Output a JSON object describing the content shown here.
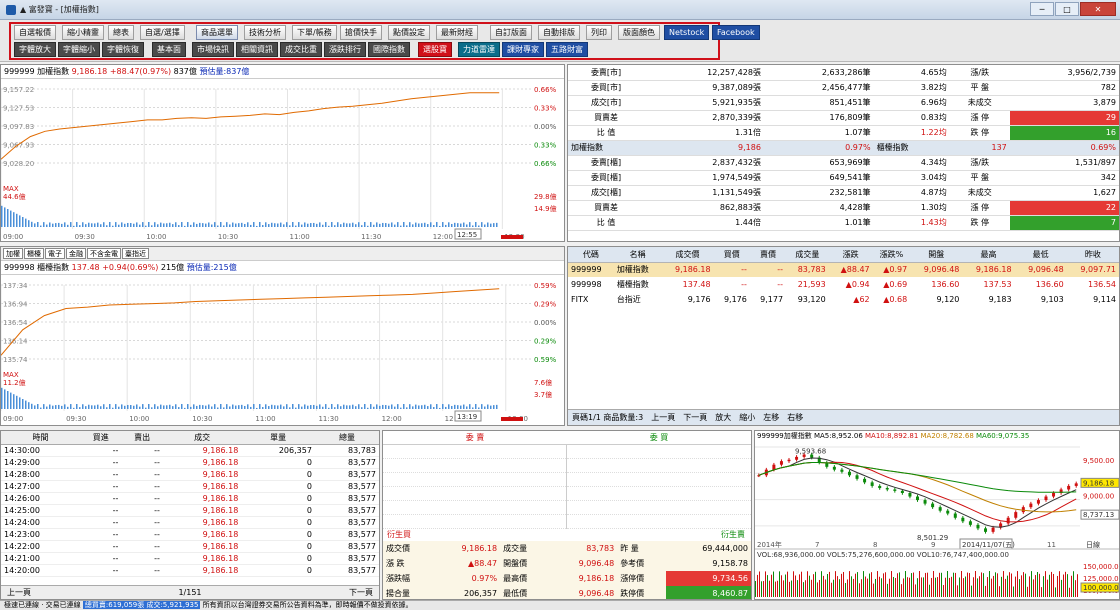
{
  "window": {
    "title": "▲ 富發寶 - [加權指數]",
    "minimize": "─",
    "maximize": "□",
    "close": "✕"
  },
  "toolbar": {
    "row1": [
      "自選報價",
      "縮小精靈",
      "總表",
      "自選/選擇",
      "商品選單",
      "技術分析",
      "下單/帳務",
      "搶價快手",
      "點價設定",
      "最新財經",
      "自訂版面",
      "自動排版",
      "列印",
      "版面顏色",
      "Netstock",
      "Facebook"
    ],
    "row2": [
      "字體放大",
      "字體縮小",
      "字體恢復",
      "基本面",
      "市場快訊",
      "相關資訊",
      "成交比重",
      "漲跌排行",
      "國際指數",
      "選股寶",
      "力道雷達",
      "課財專家",
      "五路財富"
    ]
  },
  "chart1": {
    "header_code": "999999",
    "header_name": "加權指數",
    "header_value": "9,186.18",
    "header_change": "+88.47(0.97%)",
    "header_vol": "837億",
    "header_est": "預估量:837億",
    "y_labels": [
      "9,157.22",
      "9,127.53",
      "9,097.83",
      "9,067.93",
      "9,028.20"
    ],
    "pct_labels": [
      "0.66%",
      "0.33%",
      "0.00%",
      "0.33%",
      "0.66%"
    ],
    "vol_max": "MAX",
    "vol_max_val": "44.6億",
    "vol_labels": [
      "29.8億",
      "14.9億"
    ],
    "times": [
      "09:00",
      "09:30",
      "10:00",
      "10:30",
      "11:00",
      "11:30",
      "12:00",
      "12:30"
    ],
    "time_box": "12:55",
    "price_series": [
      9098,
      9115,
      9128,
      9135,
      9138,
      9140,
      9142,
      9144,
      9146,
      9148,
      9150,
      9150,
      9152,
      9153,
      9152,
      9154,
      9155,
      9156,
      9158,
      9157,
      9160,
      9162,
      9165,
      9167,
      9168,
      9170,
      9172,
      9175,
      9178,
      9180,
      9182,
      9184,
      9186,
      9186,
      9186
    ]
  },
  "chart2": {
    "tabs": [
      "加權",
      "櫃檯",
      "電子",
      "金融",
      "不含金電",
      "臺指近"
    ],
    "header_code": "999998",
    "header_name": "櫃檯指數",
    "header_value": "137.48",
    "header_change": "+0.94(0.69%)",
    "header_vol": "215億",
    "header_est": "預估量:215億",
    "y_labels": [
      "137.34",
      "136.94",
      "136.54",
      "136.14",
      "135.74"
    ],
    "pct_labels": [
      "0.59%",
      "0.29%",
      "0.00%",
      "0.29%",
      "0.59%"
    ],
    "vol_max": "MAX",
    "vol_max_val": "11.2億",
    "vol_labels": [
      "7.6億",
      "3.7億"
    ],
    "times": [
      "09:00",
      "09:30",
      "10:00",
      "10:30",
      "11:00",
      "11:30",
      "12:00",
      "12:30",
      "13:00"
    ],
    "time_box": "13:19",
    "price_series": [
      136.54,
      136.9,
      137.1,
      137.2,
      137.22,
      137.25,
      137.26,
      137.27,
      137.28,
      137.3,
      137.31,
      137.32,
      137.33,
      137.34,
      137.35,
      137.36,
      137.37,
      137.38,
      137.39,
      137.4,
      137.42,
      137.44,
      137.46,
      137.48
    ]
  },
  "summary": {
    "twse_rows": [
      {
        "label": "委賣[市]",
        "v1": "12,257,428張",
        "v2": "2,633,286筆",
        "v3": "4.65均",
        "l2": "漲/跌",
        "v4": "3,956/2,739",
        "cls": ""
      },
      {
        "label": "委買[市]",
        "v1": "9,387,089張",
        "v2": "2,456,477筆",
        "v3": "3.82均",
        "l2": "平 盤",
        "v4": "782",
        "cls": ""
      },
      {
        "label": "成交[市]",
        "v1": "5,921,935張",
        "v2": "851,451筆",
        "v3": "6.96均",
        "l2": "未成交",
        "v4": "3,879",
        "cls": ""
      },
      {
        "label": "買賣差",
        "v1": "2,870,339張",
        "v2": "176,809筆",
        "v3": "0.83均",
        "l2": "漲 停",
        "v4": "29",
        "cls": "bgred"
      },
      {
        "label": "比 值",
        "v1": "1.31倍",
        "v2": "1.07筆",
        "v3": "1.22均",
        "l2": "跌 停",
        "v4": "16",
        "cls": "bggreen"
      }
    ],
    "twse_footer": {
      "label": "加權指數",
      "value": "9,186",
      "pct": "0.97%",
      "label2": "櫃檯指數",
      "value2": "137",
      "pct2": "0.69%"
    },
    "otc_rows": [
      {
        "label": "委賣[櫃]",
        "v1": "2,837,432張",
        "v2": "653,969筆",
        "v3": "4.34均",
        "l2": "漲/跌",
        "v4": "1,531/897",
        "cls": ""
      },
      {
        "label": "委買[櫃]",
        "v1": "1,974,549張",
        "v2": "649,541筆",
        "v3": "3.04均",
        "l2": "平 盤",
        "v4": "342",
        "cls": ""
      },
      {
        "label": "成交[櫃]",
        "v1": "1,131,549張",
        "v2": "232,581筆",
        "v3": "4.87均",
        "l2": "未成交",
        "v4": "1,627",
        "cls": ""
      },
      {
        "label": "買賣差",
        "v1": "862,883張",
        "v2": "4,428筆",
        "v3": "1.30均",
        "l2": "漲 停",
        "v4": "22",
        "cls": "bgred"
      },
      {
        "label": "比 值",
        "v1": "1.44倍",
        "v2": "1.01筆",
        "v3": "1.43均",
        "l2": "跌 停",
        "v4": "7",
        "cls": "bggreen"
      }
    ]
  },
  "quotes": {
    "headers": [
      "代碼",
      "名稱",
      "成交價",
      "買價",
      "賣價",
      "成交量",
      "漲跌",
      "漲跌%",
      "開盤",
      "最高",
      "最低",
      "昨收"
    ],
    "rows": [
      [
        "999999",
        "加權指數",
        "9,186.18",
        "--",
        "--",
        "83,783",
        "▲88.47",
        "▲0.97",
        "9,096.48",
        "9,186.18",
        "9,096.48",
        "9,097.71"
      ],
      [
        "999998",
        "櫃檯指數",
        "137.48",
        "--",
        "--",
        "21,593",
        "▲0.94",
        "▲0.69",
        "136.60",
        "137.53",
        "136.60",
        "136.54"
      ],
      [
        "FITX",
        "台指近",
        "9,176",
        "9,176",
        "9,177",
        "93,120",
        "▲62",
        "▲0.68",
        "9,120",
        "9,183",
        "9,103",
        "9,114"
      ]
    ],
    "footer": [
      "頁碼1/1 商品數量:3",
      "上一頁",
      "下一頁",
      "放大",
      "縮小",
      "左移",
      "右移"
    ]
  },
  "ticks": {
    "headers": [
      "時間",
      "買進",
      "賣出",
      "成交",
      "單量",
      "總量"
    ],
    "rows": [
      [
        "14:30:00",
        "--",
        "--",
        "9,186.18",
        "206,357",
        "83,783"
      ],
      [
        "14:29:00",
        "--",
        "--",
        "9,186.18",
        "0",
        "83,577"
      ],
      [
        "14:28:00",
        "--",
        "--",
        "9,186.18",
        "0",
        "83,577"
      ],
      [
        "14:27:00",
        "--",
        "--",
        "9,186.18",
        "0",
        "83,577"
      ],
      [
        "14:26:00",
        "--",
        "--",
        "9,186.18",
        "0",
        "83,577"
      ],
      [
        "14:25:00",
        "--",
        "--",
        "9,186.18",
        "0",
        "83,577"
      ],
      [
        "14:24:00",
        "--",
        "--",
        "9,186.18",
        "0",
        "83,577"
      ],
      [
        "14:23:00",
        "--",
        "--",
        "9,186.18",
        "0",
        "83,577"
      ],
      [
        "14:22:00",
        "--",
        "--",
        "9,186.18",
        "0",
        "83,577"
      ],
      [
        "14:21:00",
        "--",
        "--",
        "9,186.18",
        "0",
        "83,577"
      ],
      [
        "14:20:00",
        "--",
        "--",
        "9,186.18",
        "0",
        "83,577"
      ]
    ],
    "footer_prev": "上一頁",
    "page": "1/151",
    "footer_next": "下一頁"
  },
  "orderbook": {
    "bid_title": "委 賣",
    "ask_title": "委 買",
    "left_label": "衍生買",
    "right_label": "衍生賣",
    "rows": [
      {
        "l1": "成交價",
        "v1": "9,186.18",
        "l2": "成交量",
        "v2": "83,783",
        "l3": "昨 量",
        "v3": "69,444,000",
        "c3": ""
      },
      {
        "l1": "漲 跌",
        "v1": "▲88.47",
        "l2": "開盤價",
        "v2": "9,096.48",
        "l3": "參考價",
        "v3": "9,158.78",
        "c3": ""
      },
      {
        "l1": "漲跌幅",
        "v1": "0.97%",
        "l2": "最高價",
        "v2": "9,186.18",
        "l3": "漲停價",
        "v3": "9,734.56",
        "c3": "bgred"
      },
      {
        "l1": "揚合量",
        "v1": "206,357",
        "l2": "最低價",
        "v2": "9,096.48",
        "l3": "跌停價",
        "v3": "8,460.87",
        "c3": "bggreen"
      }
    ]
  },
  "kchart": {
    "header": "999999加權指數",
    "ma5": "MA5:8,952.06",
    "ma10": "MA10:8,892.81",
    "ma20": "MA20:8,782.68",
    "ma60": "MA60:9,075.35",
    "peak": "9,593.68",
    "trough": "8,501.29",
    "y_labels": [
      "9,500.00",
      "9,186.18",
      "9,000.00",
      "8,737.13"
    ],
    "x_labels": [
      "2014年",
      "7",
      "8",
      "9",
      "10",
      "11"
    ],
    "date_box": "2014/11/07(五)",
    "period": "日線",
    "vol_header": "VOL:68,936,000.00 VOL5:75,276,600,000.00 VOL10:76,747,400,000.00",
    "vol_labels": [
      "150,000.00",
      "125,000.00",
      "100,000.00"
    ],
    "vol_box": "100,000.00",
    "closes": [
      9300,
      9380,
      9450,
      9500,
      9520,
      9560,
      9593,
      9550,
      9480,
      9420,
      9380,
      9350,
      9300,
      9250,
      9200,
      9150,
      9120,
      9100,
      9080,
      9050,
      9000,
      8950,
      8900,
      8850,
      8800,
      8760,
      8700,
      8650,
      8600,
      8550,
      8501,
      8560,
      8620,
      8700,
      8780,
      8850,
      8900,
      8950,
      9000,
      9050,
      9100,
      9150,
      9186
    ]
  },
  "statusbar": {
    "left": "極速已連線 · 交易已連線",
    "highlight": "總買賣:619,059張 成交:5,921,935",
    "text": "所有資訊以台灣證券交易所公告資料為準，即時報價不做投資依據。"
  }
}
